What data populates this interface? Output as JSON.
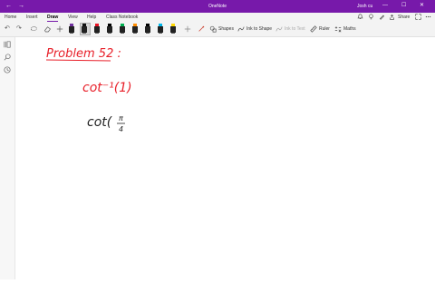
{
  "titlebar": {
    "back_glyph": "←",
    "forward_glyph": "→",
    "app_title": "OneNote",
    "user_name": "Josh cu",
    "minimize_glyph": "—",
    "maximize_glyph": "☐",
    "close_glyph": "✕",
    "background_color": "#7719aa"
  },
  "menu": {
    "tabs": [
      "Home",
      "Insert",
      "Draw",
      "View",
      "Help",
      "Class Notebook"
    ],
    "active_tab": "Draw",
    "share_label": "Share",
    "right_icons": [
      "bell-icon",
      "lightbulb-icon",
      "pen-icon",
      "fullscreen-icon",
      "share-icon",
      "more-icon"
    ]
  },
  "toolbar": {
    "undo_glyph": "↶",
    "redo_glyph": "↷",
    "shapes_label": "Shapes",
    "ink_to_shape_label": "Ink to Shape",
    "ink_to_text_label": "Ink to Text",
    "ruler_label": "Ruler",
    "maths_label": "Maths",
    "pen_colors": [
      "#7030a0",
      "#111111",
      "#e81123",
      "#000000",
      "#00b050",
      "#ff8c00",
      "#000000",
      "#00b7eb",
      "#ffd800"
    ],
    "selected_pen_index": 1
  },
  "sidebar": {
    "icons": [
      "notebooks-icon",
      "search-icon",
      "recent-icon"
    ]
  },
  "canvas": {
    "heading": "Problem 52 :",
    "line1": "cot⁻¹(1)",
    "line2": "cot(",
    "fraction_num": "π",
    "fraction_den": "4",
    "heading_color": "#e8202a",
    "line1_color": "#e8202a",
    "line2_color": "#222222"
  }
}
